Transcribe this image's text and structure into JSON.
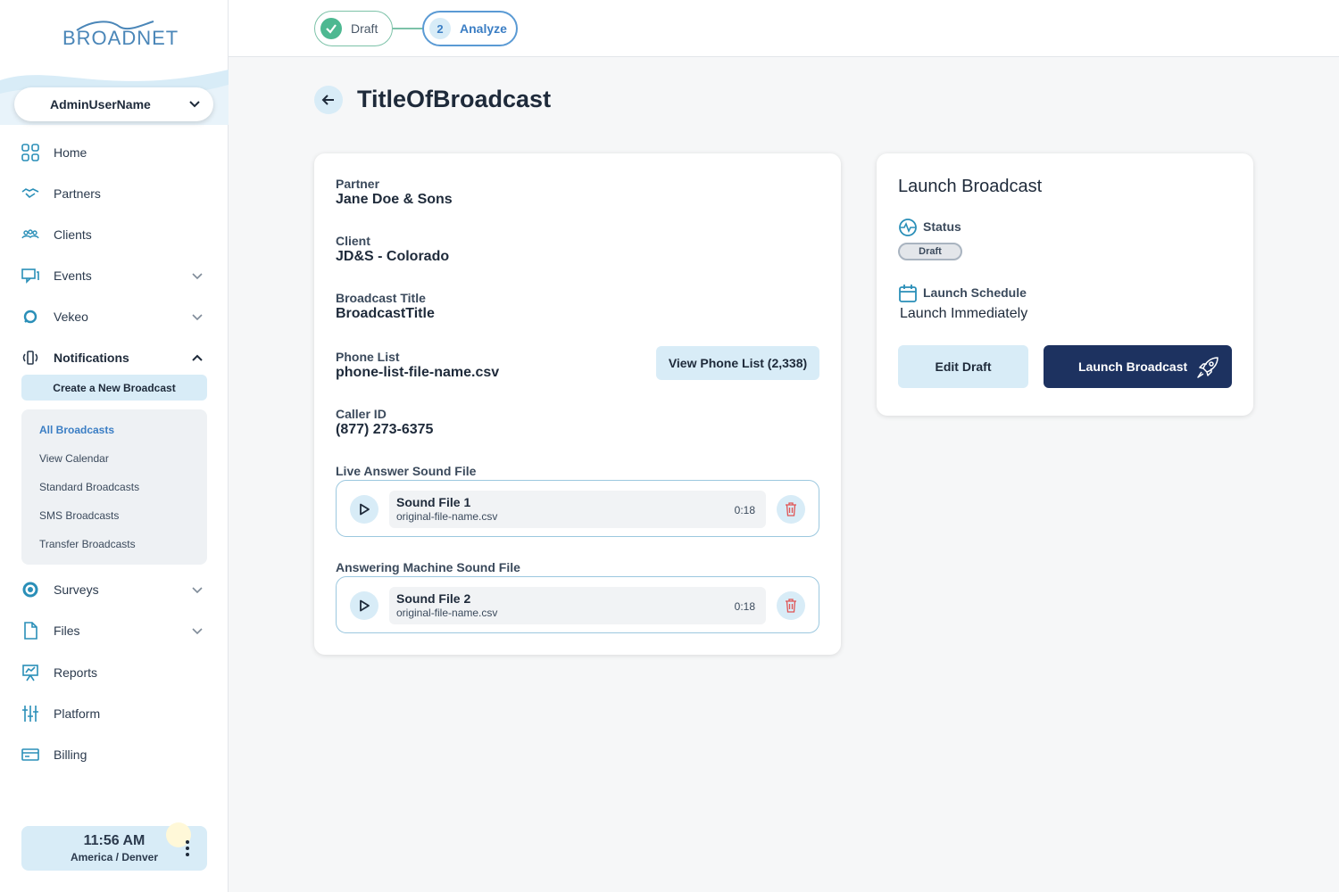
{
  "brand": {
    "logo_text": "BROADNET"
  },
  "user": {
    "name": "AdminUserName"
  },
  "nav": [
    {
      "label": "Home",
      "icon": "grid-icon"
    },
    {
      "label": "Partners",
      "icon": "handshake-icon"
    },
    {
      "label": "Clients",
      "icon": "users-icon"
    },
    {
      "label": "Events",
      "icon": "chat-icon"
    },
    {
      "label": "Vekeo",
      "icon": "chat-bubble-icon"
    },
    {
      "label": "Notifications",
      "icon": "broadcast-icon"
    },
    {
      "label": "Surveys",
      "icon": "survey-icon"
    },
    {
      "label": "Files",
      "icon": "file-icon"
    },
    {
      "label": "Reports",
      "icon": "presentation-icon"
    },
    {
      "label": "Platform",
      "icon": "sliders-icon"
    },
    {
      "label": "Billing",
      "icon": "credit-card-icon"
    }
  ],
  "notifications": {
    "create_label": "Create a New Broadcast",
    "sub_items": [
      "All Broadcasts",
      "View Calendar",
      "Standard Broadcasts",
      "SMS Broadcasts",
      "Transfer Broadcasts"
    ],
    "active": "All Broadcasts"
  },
  "clock": {
    "time": "11:56 AM",
    "timezone": "America / Denver"
  },
  "steps": [
    {
      "label": "Draft",
      "state": "complete"
    },
    {
      "number": "2",
      "label": "Analyze",
      "state": "current"
    }
  ],
  "page": {
    "title": "TitleOfBroadcast"
  },
  "details": {
    "partner_label": "Partner",
    "partner": "Jane Doe & Sons",
    "client_label": "Client",
    "client": "JD&S - Colorado",
    "broadcast_title_label": "Broadcast Title",
    "broadcast_title": "BroadcastTitle",
    "phone_list_label": "Phone List",
    "phone_list": "phone-list-file-name.csv",
    "view_phone_list_button": "View Phone List (2,338)",
    "caller_id_label": "Caller ID",
    "caller_id": "(877) 273-6375"
  },
  "sound_files": [
    {
      "section_label": "Live Answer Sound File",
      "name": "Sound File 1",
      "file": "original-file-name.csv",
      "duration": "0:18"
    },
    {
      "section_label": "Answering Machine Sound File",
      "name": "Sound File 2",
      "file": "original-file-name.csv",
      "duration": "0:18"
    }
  ],
  "launch": {
    "title": "Launch Broadcast",
    "status_label": "Status",
    "status": "Draft",
    "schedule_label": "Launch Schedule",
    "schedule": "Launch Immediately",
    "edit_button": "Edit Draft",
    "launch_button": "Launch Broadcast"
  },
  "colors": {
    "accent": "#3b7ec4",
    "navy": "#1d3260",
    "light_blue": "#d8ecf7",
    "success": "#4db891",
    "danger": "#e05454"
  }
}
